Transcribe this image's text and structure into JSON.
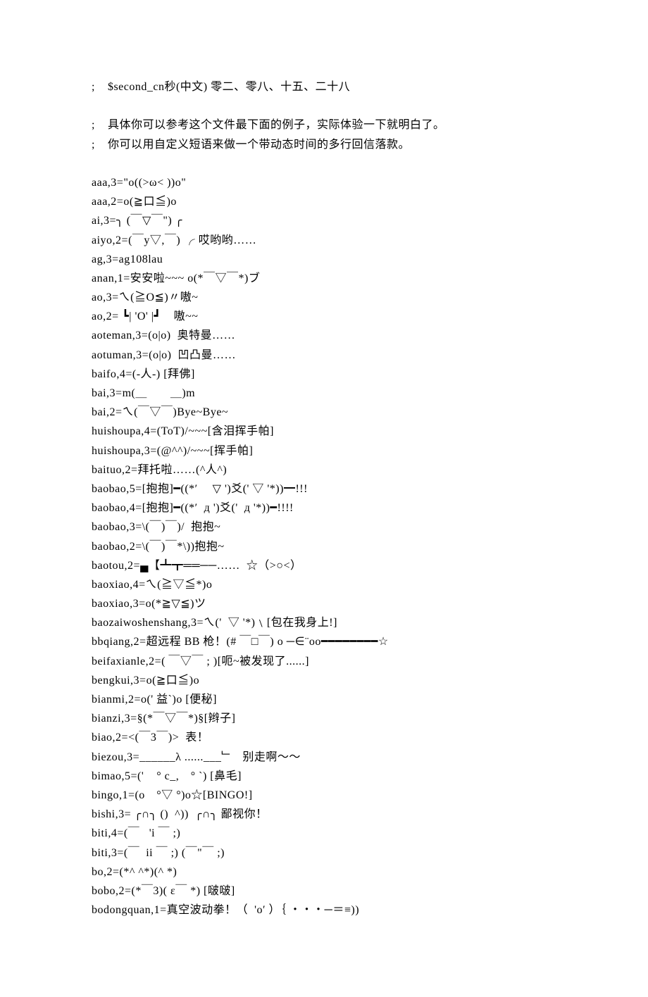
{
  "lines": [
    ";    $second_cn秒(中文) 零二、零八、十五、二十八",
    "",
    ";    具体你可以参考这个文件最下面的例子，实际体验一下就明白了。",
    ";    你可以用自定义短语来做一个带动态时间的多行回信落款。",
    "",
    "aaa,3=\"o((>ω< ))o\"",
    "aaa,2=o(≧口≦)o",
    "ai,3=╮ (￣▽￣\") ╭",
    "aiyo,2=(￣y▽,￣) ╭ 哎哟哟……",
    "ag,3=ag108lau",
    "anan,1=安安啦~~~ o(*￣▽￣*)ブ",
    "ao,3=ㄟ(≧O≦)〃嗷~",
    "ao,2= ┗| 'O' |┛    嗷~~",
    "aoteman,3=(o|o)  奥特曼……",
    "aotuman,3=(o|o)  凹凸曼……",
    "baifo,4=(-人-) [拜佛]",
    "bai,3=m(＿　　＿)m",
    "bai,2=ㄟ(￣▽￣)Bye~Bye~",
    "huishoupa,4=(ToT)/~~~[含泪挥手帕]",
    "huishoupa,3=(@^^)/~~~[挥手帕]",
    "baituo,2=拜托啦……(^人^)",
    "baobao,5=[抱抱]━((*′ 　▽ ')爻(' ▽ '*))━!!!",
    "baobao,4=[抱抱]━((*′  д ')爻('  д '*))━!!!!",
    "baobao,3=\\(￣)￣)/  抱抱~",
    "baobao,2=\\(￣)￣*\\))抱抱~",
    "baotou,2=▄【┻┳══──……  ☆（>○<）",
    "baoxiao,4=ㄟ(≧▽≦*)o",
    "baoxiao,3=o(*≧▽≦)ツ",
    "baozaiwoshenshang,3=ㄟ('  ▽ '*)﹨[包在我身上!]",
    "bbqiang,2=超远程 BB 枪！(# ￣□￣) o ─∈¨oo━━━━━━━━☆",
    "beifaxianle,2=( ￣▽￣ ; )[呃~被发现了......]",
    "bengkui,3=o(≧口≦)o",
    "bianmi,2=o(' 益`)o [便秘]",
    "bianzi,3=§(*￣▽￣*)§[辫子]",
    "biao,2=<(￣3￣)>  表！",
    "biezou,3=______λ ......___﹂   别走啊～～",
    "bimao,5=('    ° c_,　° `) [鼻毛]",
    "bingo,1=(o　°▽ °)o☆[BINGO!]",
    "bishi,3= ╭∩╮ ()  ^))  ╭∩╮ 鄙视你！",
    "biti,4=(￣   'i ￣ ;)",
    "biti,3=(￣  ii ￣ ;) (￣\"￣ ;)",
    "bo,2=(*^ ^*)(^ *)",
    "bobo,2=(*￣3)( ε￣ *) [啵啵]",
    "bodongquan,1=真空波动拳！（  'o′ ）｛ ・・・─＝≡))"
  ]
}
